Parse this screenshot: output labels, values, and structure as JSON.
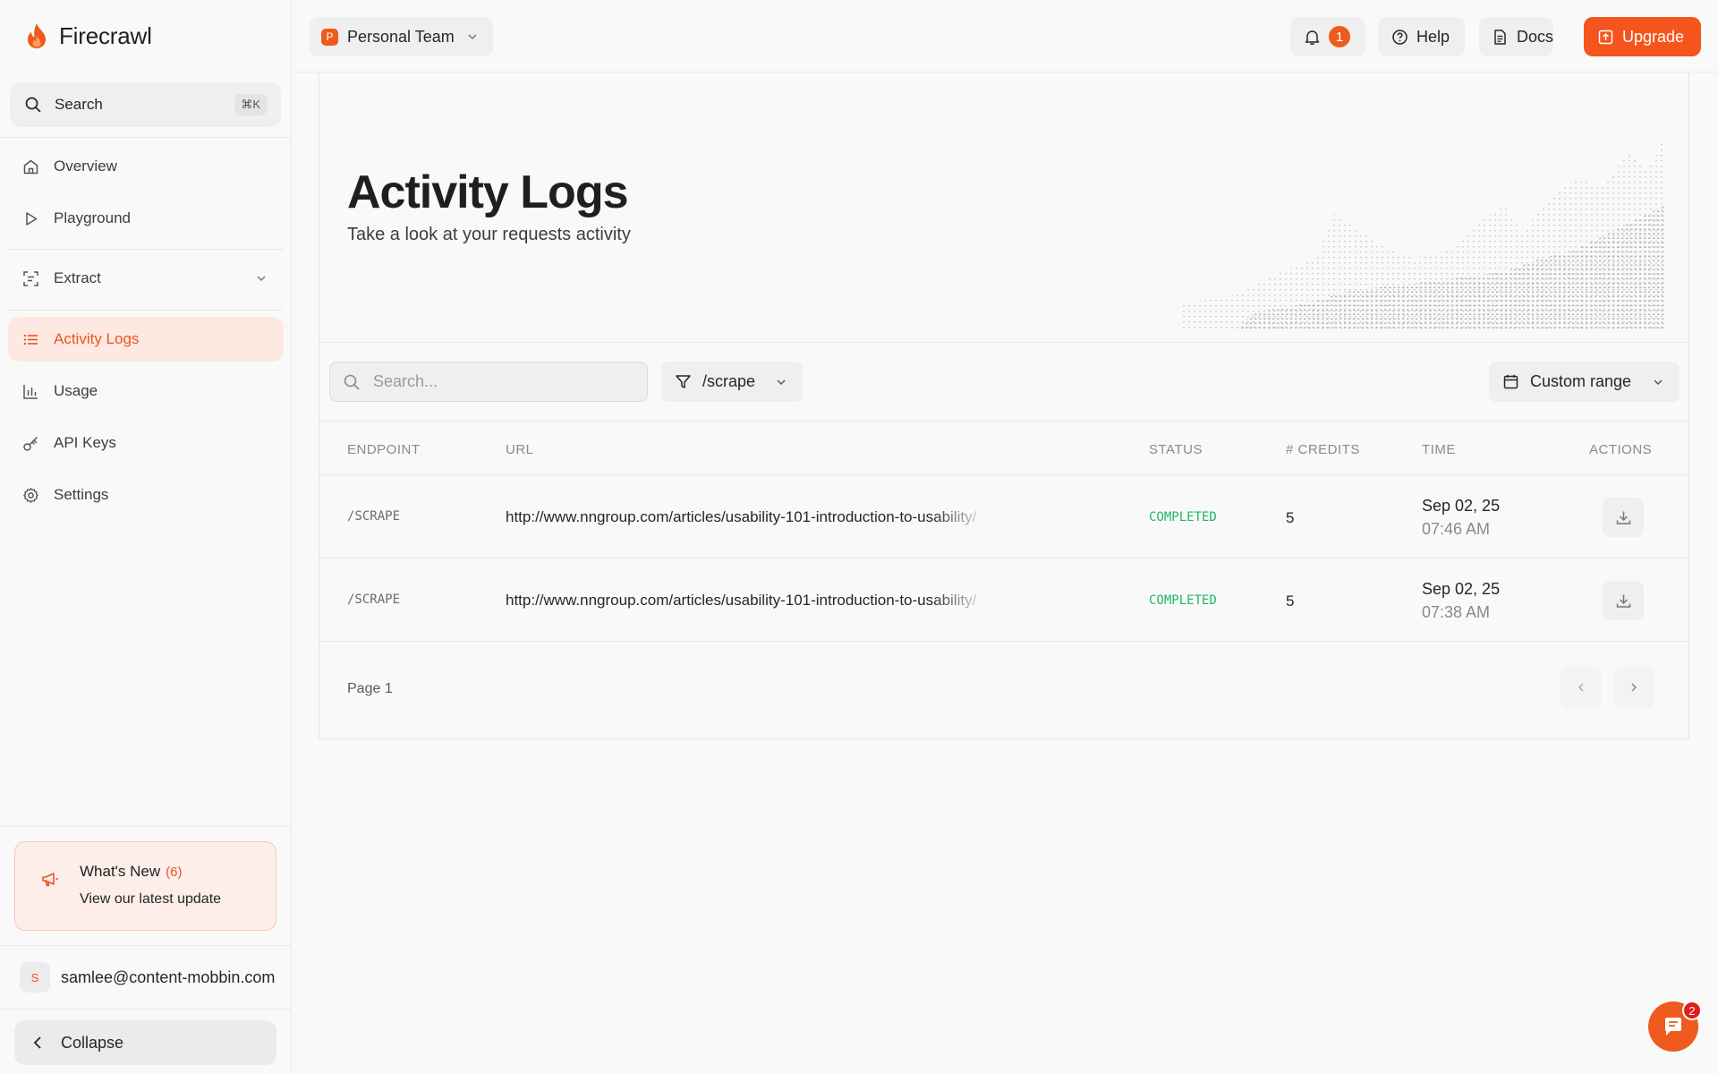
{
  "brand": {
    "name": "Firecrawl"
  },
  "sidebar": {
    "search_label": "Search",
    "search_shortcut": "⌘K",
    "items": [
      {
        "label": "Overview",
        "icon": "home-icon"
      },
      {
        "label": "Playground",
        "icon": "play-icon"
      },
      {
        "label": "Extract",
        "icon": "extract-icon"
      },
      {
        "label": "Activity Logs",
        "icon": "list-icon",
        "active": true
      },
      {
        "label": "Usage",
        "icon": "bar-chart-icon"
      },
      {
        "label": "API Keys",
        "icon": "key-icon"
      },
      {
        "label": "Settings",
        "icon": "gear-icon"
      }
    ],
    "whats_new": {
      "title": "What's New",
      "count": "(6)",
      "subtitle": "View our latest update"
    },
    "account": {
      "initial": "S",
      "email": "samlee@content-mobbin.com"
    },
    "collapse_label": "Collapse"
  },
  "topbar": {
    "team_badge": "P",
    "team_name": "Personal Team",
    "notification_count": "1",
    "help_label": "Help",
    "docs_label": "Docs",
    "upgrade_label": "Upgrade"
  },
  "page": {
    "title": "Activity Logs",
    "subtitle": "Take a look at your requests activity"
  },
  "filters": {
    "search_placeholder": "Search...",
    "endpoint_filter": "/scrape",
    "date_range": "Custom range"
  },
  "table": {
    "headers": [
      "ENDPOINT",
      "URL",
      "STATUS",
      "# CREDITS",
      "TIME",
      "ACTIONS"
    ],
    "rows": [
      {
        "endpoint": "/SCRAPE",
        "url": "http://www.nngroup.com/articles/usability-101-introduction-to-usability/",
        "status": "COMPLETED",
        "credits": "5",
        "date": "Sep 02, 25",
        "time": "07:46 AM"
      },
      {
        "endpoint": "/SCRAPE",
        "url": "http://www.nngroup.com/articles/usability-101-introduction-to-usability/",
        "status": "COMPLETED",
        "credits": "5",
        "date": "Sep 02, 25",
        "time": "07:38 AM"
      }
    ]
  },
  "pagination": {
    "label": "Page 1"
  },
  "chat": {
    "badge": "2"
  },
  "colors": {
    "accent": "#f05a1e",
    "status_completed": "#1fb764",
    "active_bg": "#fde9e2"
  }
}
